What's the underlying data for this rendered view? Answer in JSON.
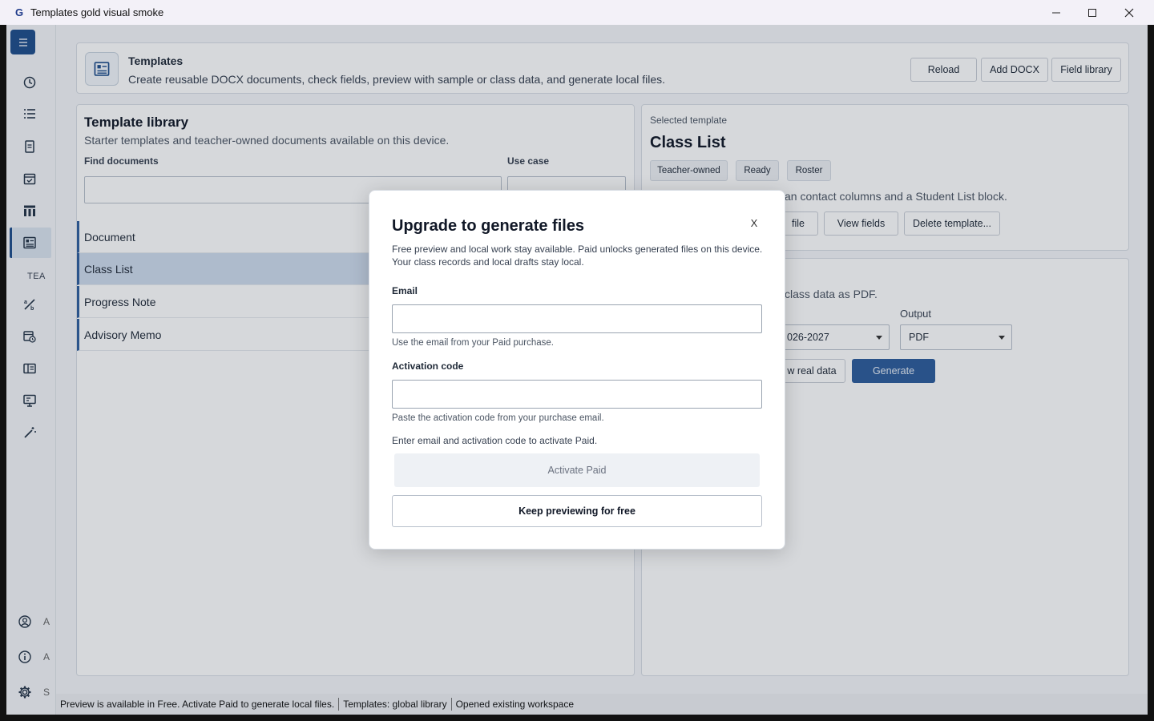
{
  "window": {
    "title": "Templates gold visual smoke",
    "app_icon": "G"
  },
  "sidebar": {
    "section_label": "TEA",
    "items": [
      {
        "icon": "history-icon"
      },
      {
        "icon": "list-icon"
      },
      {
        "icon": "document-icon"
      },
      {
        "icon": "calendar-check-icon"
      },
      {
        "icon": "columns-icon"
      },
      {
        "icon": "templates-icon"
      },
      {
        "icon": "grades-icon"
      },
      {
        "icon": "schedule-icon"
      },
      {
        "icon": "book-icon"
      },
      {
        "icon": "presentation-icon"
      },
      {
        "icon": "magic-wand-icon"
      }
    ],
    "footer": [
      {
        "icon": "account-icon",
        "label": "A"
      },
      {
        "icon": "info-icon",
        "label": "A"
      },
      {
        "icon": "settings-icon",
        "label": "S"
      }
    ]
  },
  "header": {
    "title": "Templates",
    "subtitle": "Create reusable DOCX documents, check fields, preview with sample or class data, and generate local files.",
    "buttons": {
      "reload": "Reload",
      "add_docx": "Add DOCX",
      "field_library": "Field library"
    }
  },
  "library": {
    "title": "Template library",
    "subtitle": "Starter templates and teacher-owned documents available on this device.",
    "find_label": "Find documents",
    "find_value": "",
    "use_case_label": "Use case",
    "use_case_value": "",
    "items": [
      "Document",
      "Class List",
      "Progress Note",
      "Advisory Memo"
    ],
    "selected_index": 1
  },
  "selected": {
    "label": "Selected template",
    "title": "Class List",
    "chips": [
      "Teacher-owned",
      "Ready",
      "Roster"
    ],
    "description_visible": "an contact columns and a Student List block.",
    "buttons": {
      "file": "file",
      "view_fields": "View fields",
      "delete": "Delete template..."
    }
  },
  "generate": {
    "description_visible": "class data as PDF.",
    "year_value": "026-2027",
    "output_label": "Output",
    "output_value": "PDF",
    "real_data_button": "w real data",
    "generate_button": "Generate",
    "accent": "#2c5c9c"
  },
  "status": {
    "messages": [
      "Preview is available in Free. Activate Paid to generate local files.",
      "Templates: global library",
      "Opened existing workspace"
    ]
  },
  "dialog": {
    "title": "Upgrade to generate files",
    "close_label": "X",
    "description": "Free preview and local work stay available. Paid unlocks generated files on this device. Your class records and local drafts stay local.",
    "email_label": "Email",
    "email_value": "",
    "email_hint": "Use the email from your Paid purchase.",
    "code_label": "Activation code",
    "code_value": "",
    "code_hint": "Paste the activation code from your purchase email.",
    "note": "Enter email and activation code to activate Paid.",
    "activate_button": "Activate Paid",
    "keep_button": "Keep previewing for free"
  }
}
